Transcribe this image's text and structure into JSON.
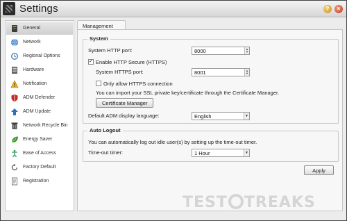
{
  "window": {
    "title": "Settings",
    "help_icon": "?",
    "close_icon": "×"
  },
  "sidebar": {
    "items": [
      {
        "label": "General",
        "icon": "server-icon",
        "active": true
      },
      {
        "label": "Network",
        "icon": "network-globe-icon",
        "active": false
      },
      {
        "label": "Regional Options",
        "icon": "clock-icon",
        "active": false
      },
      {
        "label": "Hardware",
        "icon": "hardware-icon",
        "active": false
      },
      {
        "label": "Notification",
        "icon": "warning-icon",
        "active": false
      },
      {
        "label": "ADM Defender",
        "icon": "shield-icon",
        "active": false
      },
      {
        "label": "ADM Update",
        "icon": "arrow-up-icon",
        "active": false
      },
      {
        "label": "Network Recycle Bin",
        "icon": "recycle-bin-icon",
        "active": false
      },
      {
        "label": "Energy Saver",
        "icon": "leaf-icon",
        "active": false
      },
      {
        "label": "Ease of Access",
        "icon": "access-icon",
        "active": false
      },
      {
        "label": "Factory Default",
        "icon": "reset-icon",
        "active": false
      },
      {
        "label": "Registration",
        "icon": "document-icon",
        "active": false
      }
    ]
  },
  "tab": {
    "label": "Management"
  },
  "system": {
    "title": "System",
    "http_port_label": "System HTTP port:",
    "http_port_value": "8000",
    "https_enable_label": "Enable HTTP Secure (HTTPS)",
    "https_enabled": true,
    "https_port_label": "System HTTPS port:",
    "https_port_value": "8001",
    "only_https_label": "Only allow HTTPS connection",
    "only_https": false,
    "import_note": "You can import your SSL private key/certificate through the Certificate Manager.",
    "cert_button": "Certificate Manager",
    "language_label": "Default ADM display language:",
    "language_value": "English"
  },
  "auto_logout": {
    "title": "Auto Logout",
    "note": "You can automatically log out idle user(s) by setting up the time-out timer.",
    "timer_label": "Time-out timer:",
    "timer_value": "1 Hour"
  },
  "apply_button": "Apply",
  "watermark": {
    "left": "TEST",
    "right": "TREAKS"
  },
  "colors": {
    "active_item": "#d4d4d4",
    "panel_bg": "#f7f7f7",
    "check_mark": "#2a6b1f"
  }
}
